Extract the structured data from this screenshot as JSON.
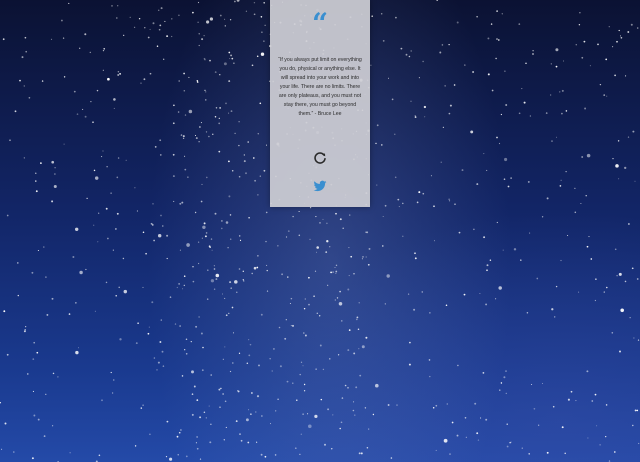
{
  "quote": {
    "mark": "“",
    "text": "“If you always put limit on everything you do, physical or anything else. It will spread into your work and into your life. There are no limits. There are only plateaus, and you must not stay there, you must go beyond them.” - Bruce Lee"
  },
  "icons": {
    "refresh": "refresh-icon",
    "share": "twitter-icon"
  },
  "colors": {
    "accent": "#3a8fd0",
    "card_background": "#cdcdd4",
    "sky_dark": "#0b1233",
    "sky_light": "#244aa8"
  }
}
